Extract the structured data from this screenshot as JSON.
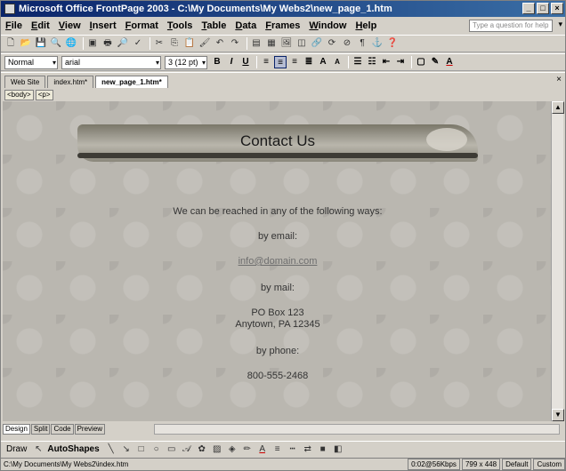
{
  "window": {
    "title": "Microsoft Office FrontPage 2003 - C:\\My Documents\\My Webs2\\new_page_1.htm",
    "controls": {
      "minimize": "_",
      "maximize": "□",
      "close": "×"
    }
  },
  "menu": {
    "items": [
      "File",
      "Edit",
      "View",
      "Insert",
      "Format",
      "Tools",
      "Table",
      "Data",
      "Frames",
      "Window",
      "Help"
    ],
    "help_placeholder": "Type a question for help"
  },
  "formatting": {
    "style": "Normal",
    "font": "arial",
    "size": "3 (12 pt)",
    "bold": "B",
    "italic": "I",
    "underline": "U"
  },
  "tabs": [
    {
      "label": "Web Site"
    },
    {
      "label": "index.htm*"
    },
    {
      "label": "new_page_1.htm*"
    }
  ],
  "tag_selector": [
    "<body>",
    "<p>"
  ],
  "page": {
    "banner_title": "Contact Us",
    "intro": "We can be reached in any of the following ways:",
    "email_label": "by email:",
    "email_link": "info@domain.com",
    "mail_label": "by mail:",
    "address_line1": "PO Box 123",
    "address_line2": "Anytown, PA 12345",
    "phone_label": "by phone:",
    "phone": "800-555-2468"
  },
  "view_tabs": [
    "Design",
    "Split",
    "Code",
    "Preview"
  ],
  "drawing": {
    "draw_label": "Draw",
    "autoshapes_label": "AutoShapes"
  },
  "status": {
    "path": "C:\\My Documents\\My Webs2\\index.htm",
    "speed": "0:02@56Kbps",
    "dims": "799 x 448",
    "mode": "Default",
    "custom": "Custom"
  },
  "colors": {
    "titlebar": "#0a246a",
    "page_background": "#bab7b0",
    "link": "#6e6e6e"
  }
}
